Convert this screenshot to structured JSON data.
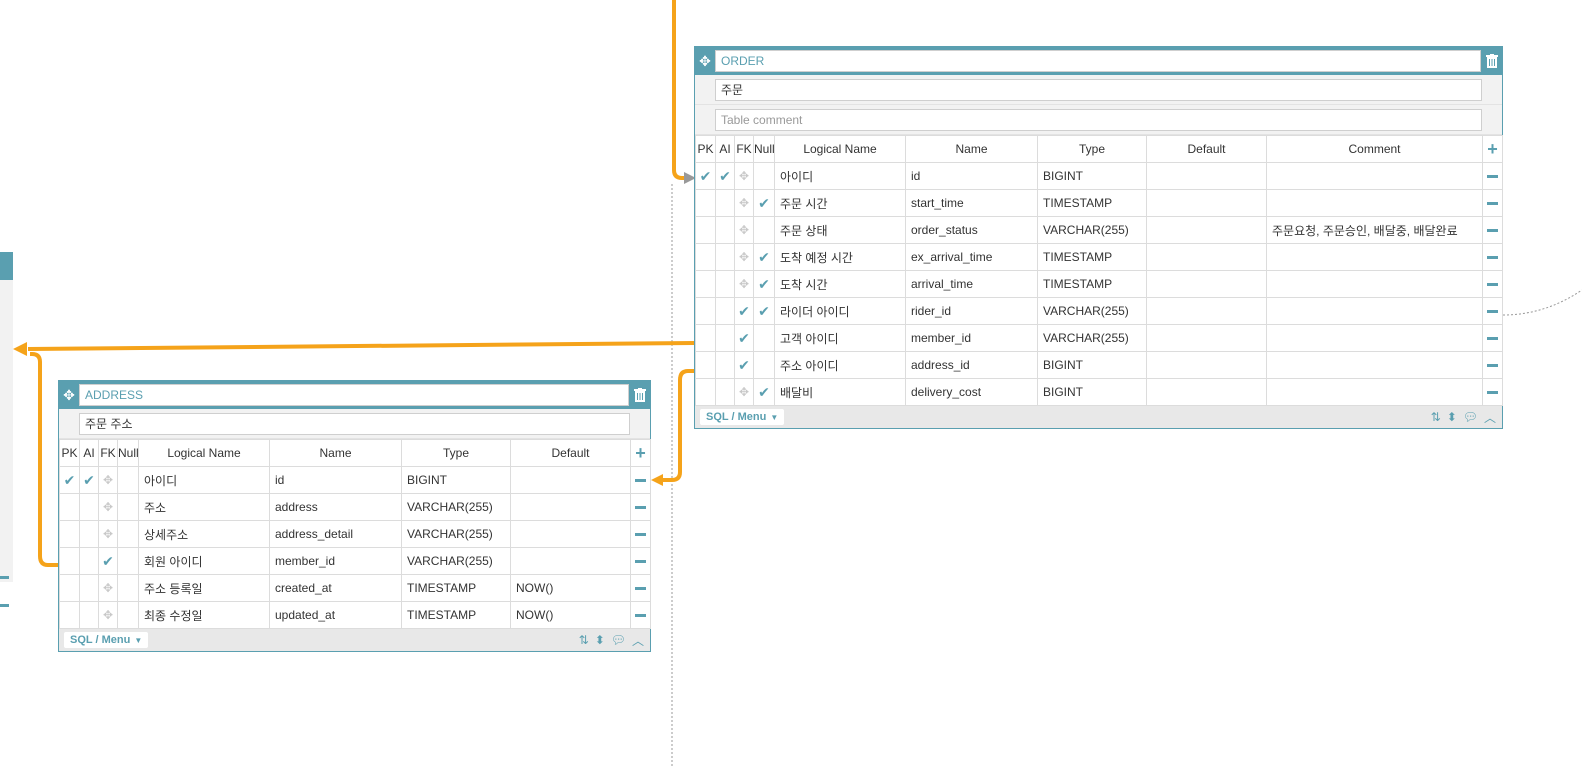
{
  "colors": {
    "accent": "#5a9fb0",
    "relation": "#f5a31a",
    "connector_dotted": "#999999"
  },
  "order_table": {
    "name": "ORDER",
    "logical_name": "주문",
    "comment_placeholder": "Table comment",
    "headers": {
      "pk": "PK",
      "ai": "AI",
      "fk": "FK",
      "null": "Null",
      "logical": "Logical Name",
      "name": "Name",
      "type": "Type",
      "default": "Default",
      "comment": "Comment"
    },
    "rows": [
      {
        "pk": true,
        "ai": true,
        "fk": "drag",
        "null": false,
        "logical": "아이디",
        "name": "id",
        "type": "BIGINT",
        "default": "",
        "comment": ""
      },
      {
        "pk": false,
        "ai": false,
        "fk": "drag",
        "null": true,
        "logical": "주문 시간",
        "name": "start_time",
        "type": "TIMESTAMP",
        "default": "",
        "comment": ""
      },
      {
        "pk": false,
        "ai": false,
        "fk": "drag",
        "null": false,
        "logical": "주문 상태",
        "name": "order_status",
        "type": "VARCHAR(255)",
        "default": "",
        "comment": "주문요청, 주문승인, 배달중, 배달완료"
      },
      {
        "pk": false,
        "ai": false,
        "fk": "drag",
        "null": true,
        "logical": "도착 예정 시간",
        "name": "ex_arrival_time",
        "type": "TIMESTAMP",
        "default": "",
        "comment": ""
      },
      {
        "pk": false,
        "ai": false,
        "fk": "drag",
        "null": true,
        "logical": "도착 시간",
        "name": "arrival_time",
        "type": "TIMESTAMP",
        "default": "",
        "comment": ""
      },
      {
        "pk": false,
        "ai": false,
        "fk": "check",
        "null": true,
        "logical": "라이더 아이디",
        "name": "rider_id",
        "type": "VARCHAR(255)",
        "default": "",
        "comment": ""
      },
      {
        "pk": false,
        "ai": false,
        "fk": "check",
        "null": false,
        "logical": "고객 아이디",
        "name": "member_id",
        "type": "VARCHAR(255)",
        "default": "",
        "comment": ""
      },
      {
        "pk": false,
        "ai": false,
        "fk": "check",
        "null": false,
        "logical": "주소 아이디",
        "name": "address_id",
        "type": "BIGINT",
        "default": "",
        "comment": ""
      },
      {
        "pk": false,
        "ai": false,
        "fk": "drag",
        "null": true,
        "logical": "배달비",
        "name": "delivery_cost",
        "type": "BIGINT",
        "default": "",
        "comment": ""
      }
    ],
    "footer_menu": "SQL / Menu"
  },
  "address_table": {
    "name": "ADDRESS",
    "logical_name": "주문 주소",
    "headers": {
      "pk": "PK",
      "ai": "AI",
      "fk": "FK",
      "null": "Null",
      "logical": "Logical Name",
      "name": "Name",
      "type": "Type",
      "default": "Default"
    },
    "rows": [
      {
        "pk": true,
        "ai": true,
        "fk": "drag",
        "null": false,
        "logical": "아이디",
        "name": "id",
        "type": "BIGINT",
        "default": ""
      },
      {
        "pk": false,
        "ai": false,
        "fk": "drag",
        "null": false,
        "logical": "주소",
        "name": "address",
        "type": "VARCHAR(255)",
        "default": ""
      },
      {
        "pk": false,
        "ai": false,
        "fk": "drag",
        "null": false,
        "logical": "상세주소",
        "name": "address_detail",
        "type": "VARCHAR(255)",
        "default": ""
      },
      {
        "pk": false,
        "ai": false,
        "fk": "check",
        "null": false,
        "logical": "회원 아이디",
        "name": "member_id",
        "type": "VARCHAR(255)",
        "default": ""
      },
      {
        "pk": false,
        "ai": false,
        "fk": "drag",
        "null": false,
        "logical": "주소 등록일",
        "name": "created_at",
        "type": "TIMESTAMP",
        "default": "NOW()"
      },
      {
        "pk": false,
        "ai": false,
        "fk": "drag",
        "null": false,
        "logical": "최종 수정일",
        "name": "updated_at",
        "type": "TIMESTAMP",
        "default": "NOW()"
      }
    ],
    "footer_menu": "SQL / Menu"
  },
  "icons": {
    "move": "move-icon",
    "trash": "trash-icon",
    "add": "plus-icon",
    "remove": "minus-icon",
    "sort": "sort-icon",
    "expand": "updown-icon",
    "comment": "comment-icon",
    "collapse": "chevron-up-icon"
  }
}
